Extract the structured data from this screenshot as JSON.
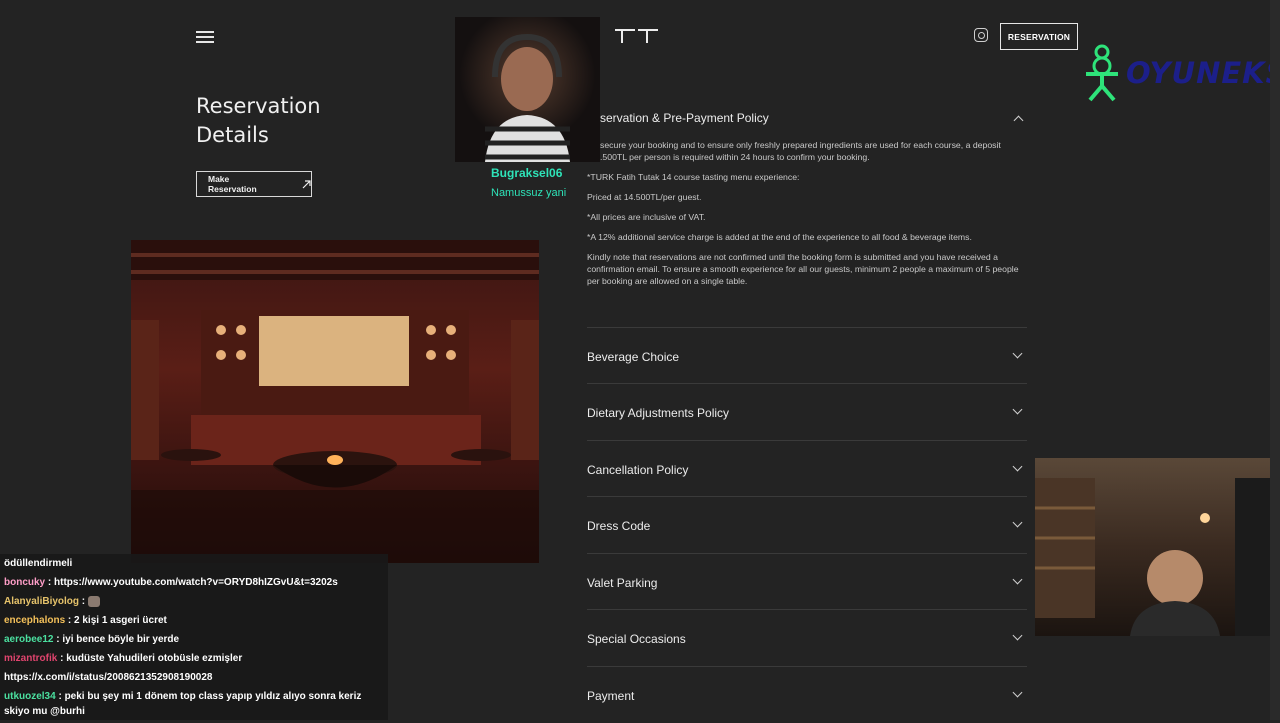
{
  "header": {
    "menu_icon": "hamburger-icon",
    "logo_glyph": "TT",
    "instagram_icon": "instagram-icon",
    "reservation_label": "RESERVATION"
  },
  "page": {
    "title_line1": "Reservation",
    "title_line2": "Details",
    "make_reservation_label": "Make Reservation",
    "make_reservation_icon": "arrow-up-right-icon"
  },
  "streamer": {
    "name": "Bugraksel06",
    "subtitle": "Namussuz yani"
  },
  "policy": {
    "heading": "servation & Pre-Payment Policy",
    "p1": "secure your booking and to ensure only freshly prepared ingredients are used for each course, a deposit .500TL per person is required within 24 hours to confirm your booking.",
    "p2": "*TURK Fatih Tutak 14 course tasting menu experience:",
    "p3": "Priced at 14.500TL/per guest.",
    "p4": "*All prices are inclusive of VAT.",
    "p5": "*A 12% additional service charge is added at the end of the experience to all food & beverage items.",
    "p6": "Kindly note that reservations are not confirmed until the booking form is submitted and you have received a confirmation email. To ensure a smooth experience for all our guests, minimum 2 people a maximum of 5 people per booking are allowed on a single table."
  },
  "accordion": [
    {
      "label": "Beverage Choice"
    },
    {
      "label": "Dietary Adjustments Policy"
    },
    {
      "label": "Cancellation Policy"
    },
    {
      "label": "Dress Code"
    },
    {
      "label": "Valet Parking"
    },
    {
      "label": "Special Occasions"
    },
    {
      "label": "Payment"
    }
  ],
  "brand": {
    "text": "OYUNEKS",
    "icon": "mascot-icon",
    "color": "#1c1f8a",
    "accent": "#2ee37a"
  },
  "chat": [
    {
      "user": "",
      "msg": "ödüllendirmeli",
      "color": "#ffffff"
    },
    {
      "user": "boncuky",
      "msg": ": https://www.youtube.com/watch?v=ORYD8hIZGvU&t=3202s",
      "color": "#ff9ec8"
    },
    {
      "user": "AlanyaliBiyolog",
      "msg": ":",
      "color": "#e6c36b"
    },
    {
      "user": "encephalons",
      "msg": ": 2 kişi 1 asgeri ücret",
      "color": "#f3c05a"
    },
    {
      "user": "aerobee12",
      "msg": ": iyi bence böyle bir yerde",
      "color": "#4be0a0"
    },
    {
      "user": "mizantrofik",
      "msg": ": kudüste Yahudileri otobüsle ezmişler",
      "color": "#e0446e"
    },
    {
      "user": "",
      "msg": "https://x.com/i/status/2008621352908190028",
      "color": "#ffffff"
    },
    {
      "user": "utkuozel34",
      "msg": ": peki bu şey mi 1 dönem top class yapıp yıldız alıyo sonra keriz skiyo mu @burhi",
      "color": "#4be0a0"
    }
  ]
}
